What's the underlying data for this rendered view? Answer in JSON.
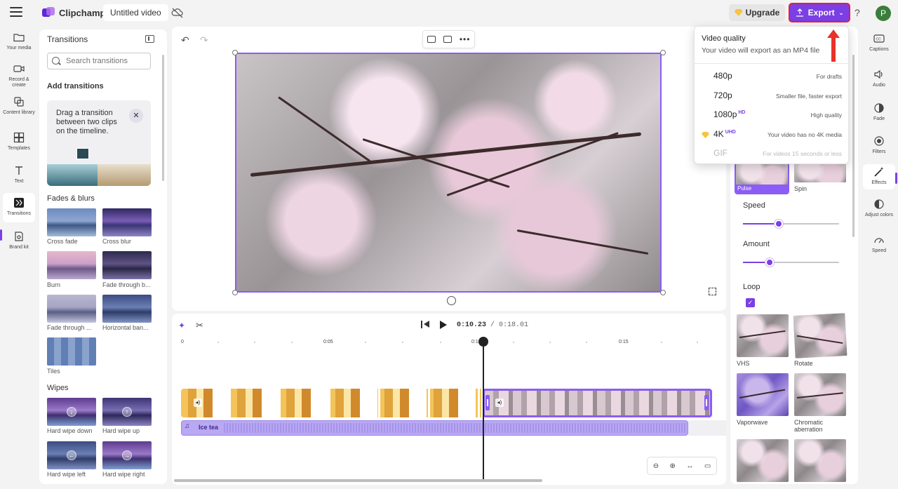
{
  "topbar": {
    "app_name": "Clipchamp",
    "project_title": "Untitled video",
    "upgrade_label": "Upgrade",
    "export_label": "Export",
    "help_label": "?",
    "avatar_initial": "P"
  },
  "left_nav": [
    {
      "label": "Your media",
      "icon": "folder-icon"
    },
    {
      "label": "Record & create",
      "icon": "camera-icon"
    },
    {
      "label": "Content library",
      "icon": "library-icon"
    },
    {
      "label": "Templates",
      "icon": "templates-icon"
    },
    {
      "label": "Text",
      "icon": "text-icon"
    },
    {
      "label": "Transitions",
      "icon": "transitions-icon",
      "active": true
    },
    {
      "label": "Brand kit",
      "icon": "brand-kit-icon"
    }
  ],
  "transitions_panel": {
    "title": "Transitions",
    "search_placeholder": "Search transitions",
    "add_title": "Add transitions",
    "hint_text": "Drag a transition between two clips on the timeline.",
    "sections": {
      "fades": "Fades & blurs",
      "wipes": "Wipes"
    },
    "fade_items": [
      "Cross fade",
      "Cross blur",
      "Burn",
      "Fade through b...",
      "Fade through ...",
      "Horizontal ban...",
      "Tiles"
    ],
    "wipe_items": [
      "Hard wipe down",
      "Hard wipe up",
      "Hard wipe left",
      "Hard wipe right"
    ]
  },
  "timeline": {
    "current_time": "0:10.23",
    "total_time": "/ 0:18.01",
    "ruler_labels": [
      "0",
      "0:05",
      "0:1",
      "0:15"
    ],
    "audio_clip_name": "Ice tea"
  },
  "export_dropdown": {
    "title": "Video quality",
    "subtitle": "Your video will export as an MP4 file",
    "options": [
      {
        "resolution": "480p",
        "badge": "",
        "description": "For drafts"
      },
      {
        "resolution": "720p",
        "badge": "",
        "description": "Smaller file, faster export"
      },
      {
        "resolution": "1080p",
        "badge": "HD",
        "description": "High quality"
      },
      {
        "resolution": "4K",
        "badge": "UHD",
        "description": "Your video has no 4K media"
      },
      {
        "resolution": "GIF",
        "badge": "",
        "description": "For videos 15 seconds or less"
      }
    ]
  },
  "effects_panel": {
    "pulse_label": "Pulse",
    "spin_label": "Spin",
    "speed_label": "Speed",
    "speed_value": 0.37,
    "amount_label": "Amount",
    "amount_value": 0.28,
    "loop_label": "Loop",
    "loop_checked": true,
    "effects": [
      "VHS",
      "Rotate",
      "Vaporwave",
      "Chromatic aberration"
    ]
  },
  "right_nav": [
    {
      "label": "Captions",
      "icon": "captions-icon"
    },
    {
      "label": "Audio",
      "icon": "speaker-icon"
    },
    {
      "label": "Fade",
      "icon": "fade-icon"
    },
    {
      "label": "Filters",
      "icon": "filters-icon"
    },
    {
      "label": "Effects",
      "icon": "magic-wand-icon",
      "active": true
    },
    {
      "label": "Adjust colors",
      "icon": "adjust-colors-icon"
    },
    {
      "label": "Speed",
      "icon": "speedometer-icon"
    }
  ],
  "colors": {
    "accent": "#7b3fe4",
    "selection": "#8b5cf6",
    "highlight_border": "#e81c3b"
  }
}
